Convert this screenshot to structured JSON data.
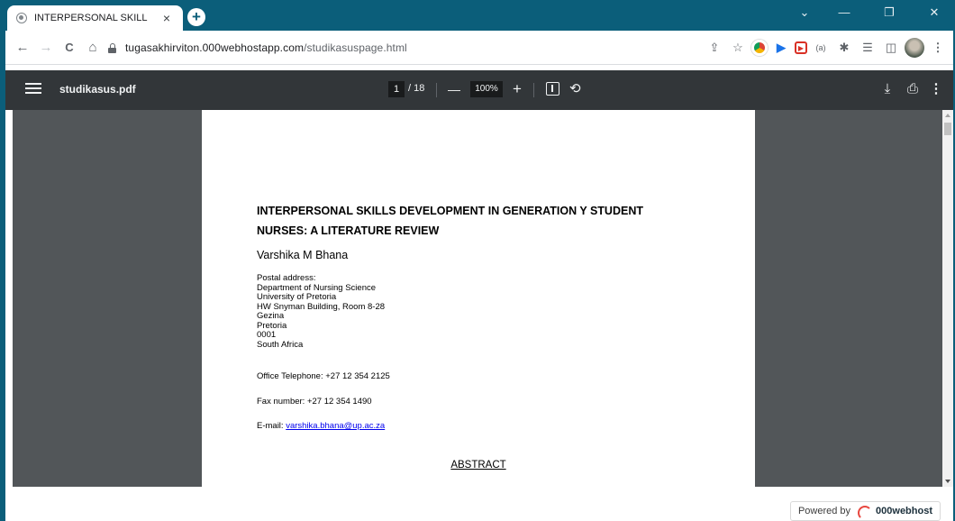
{
  "browser": {
    "tab_title": "INTERPERSONAL SKILL",
    "tab_close": "×",
    "new_tab": "+",
    "window_controls": {
      "menu": "⌄",
      "minimize": "—",
      "restore": "❐",
      "close": "✕"
    },
    "nav": {
      "back": "←",
      "forward": "→",
      "reload": "C",
      "home": "⌂"
    },
    "url_domain": "tugasakhirviton.000webhostapp.com",
    "url_path": "/studikasuspage.html",
    "toolbar_icons": [
      "share-icon",
      "star-icon",
      "chrome-ext-icon",
      "ext-blue-icon",
      "ext-red-icon",
      "ext-bracket-icon",
      "puzzle-icon",
      "reading-list-icon",
      "side-panel-icon",
      "avatar",
      "kebab-menu-icon"
    ],
    "toolbar_glyphs": {
      "share": "⇪",
      "star": "☆",
      "ext_blue": "▶",
      "ext_red": "▶",
      "ext_bracket": "(a)",
      "puzzle": "✱",
      "reading_list": "☰",
      "side_panel": "◫",
      "menu": "⋮"
    }
  },
  "pdf_viewer": {
    "file_name": "studikasus.pdf",
    "current_page": "1",
    "total_pages": "/ 18",
    "zoom": "100%",
    "zoom_out": "—",
    "zoom_in": "+",
    "rotate": "⟲",
    "download": "⤓",
    "print": "⎙",
    "more": "⋮"
  },
  "document": {
    "title_line1": "INTERPERSONAL SKILLS DEVELOPMENT IN GENERATION Y STUDENT",
    "title_line2": "NURSES: A LITERATURE REVIEW",
    "author": "Varshika M Bhana",
    "address": [
      "Postal address:",
      "Department of Nursing Science",
      "University of Pretoria",
      "HW Snyman Building, Room 8-28",
      "Gezina",
      "Pretoria",
      "0001",
      "South Africa"
    ],
    "office_telephone": "Office Telephone: +27 12 354 2125",
    "fax": "Fax number: +27 12 354 1490",
    "email_label": "E-mail: ",
    "email": "varshika.bhana@up.ac.za",
    "abstract_heading": "ABSTRACT"
  },
  "footer": {
    "powered_by": "Powered by",
    "brand": "000webhost"
  },
  "colors": {
    "chrome_frame": "#0b5e7a",
    "pdf_toolbar": "#323639",
    "viewer_bg": "#525659",
    "link": "#0000ee"
  }
}
